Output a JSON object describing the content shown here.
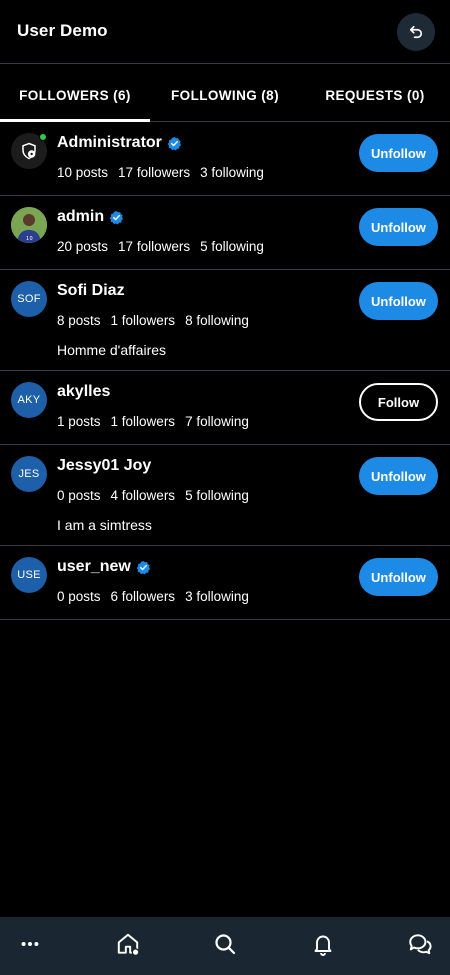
{
  "header": {
    "title": "User Demo",
    "back_icon": "undo-icon"
  },
  "tabs": [
    {
      "label": "FOLLOWERS (6)",
      "active": true
    },
    {
      "label": "FOLLOWING (8)",
      "active": false
    },
    {
      "label": "REQUESTS (0)",
      "active": false
    }
  ],
  "users": [
    {
      "name": "Administrator",
      "verified": true,
      "avatar": "admin-shield-icon",
      "online": true,
      "posts": "10 posts",
      "followers": "17 followers",
      "following": "3 following",
      "bio": "",
      "button": "Unfollow"
    },
    {
      "name": "admin",
      "verified": true,
      "avatar": "photo",
      "posts": "20 posts",
      "followers": "17 followers",
      "following": "5 following",
      "bio": "",
      "button": "Unfollow"
    },
    {
      "name": "Sofi Diaz",
      "verified": false,
      "avatar_initials": "SOF",
      "posts": "8 posts",
      "followers": "1 followers",
      "following": "8 following",
      "bio": "Homme d'affaires",
      "button": "Unfollow"
    },
    {
      "name": "akylles",
      "verified": false,
      "avatar_initials": "AKY",
      "posts": "1 posts",
      "followers": "1 followers",
      "following": "7 following",
      "bio": "",
      "button": "Follow"
    },
    {
      "name": "Jessy01 Joy",
      "verified": false,
      "avatar_initials": "JES",
      "posts": "0 posts",
      "followers": "4 followers",
      "following": "5 following",
      "bio": "I am a simtress",
      "button": "Unfollow"
    },
    {
      "name": "user_new",
      "verified": true,
      "avatar_initials": "USE",
      "posts": "0 posts",
      "followers": "6 followers",
      "following": "3 following",
      "bio": "",
      "button": "Unfollow"
    }
  ],
  "bottom_nav": [
    {
      "icon": "more-icon"
    },
    {
      "icon": "home-icon"
    },
    {
      "icon": "search-icon"
    },
    {
      "icon": "bell-icon"
    },
    {
      "icon": "chat-icon"
    }
  ],
  "colors": {
    "background": "#000000",
    "accent": "#1d8be6",
    "avatar": "#1d5fa8",
    "nav": "#1a2733",
    "verified": "#1d8be6",
    "online": "#2ecc40"
  }
}
